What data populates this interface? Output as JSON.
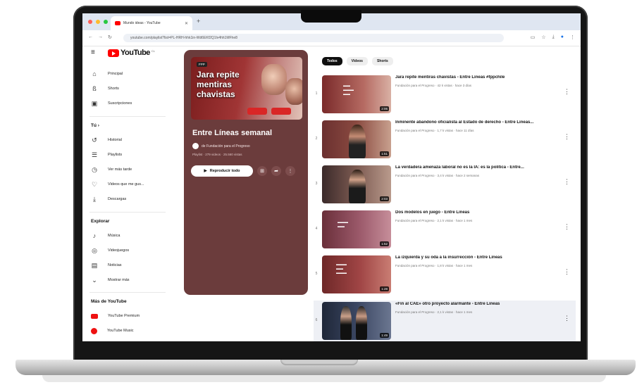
{
  "browser": {
    "tab_title": "Mundo ideas - YouTube",
    "url": "youtube.com/playlist?list=PL-HRH-hhk1in-Wd6EKf2Q1lv4hh1MFhe8",
    "dot_colors": [
      "#ff5f57",
      "#febc2e",
      "#28c840"
    ]
  },
  "header": {
    "logo_text": "YouTube"
  },
  "sidebar": {
    "main": [
      {
        "label": "Principal",
        "icon": "home-icon"
      },
      {
        "label": "Shorts",
        "icon": "shorts-icon"
      },
      {
        "label": "Suscripciones",
        "icon": "subscriptions-icon"
      }
    ],
    "you_heading": "Tú",
    "you_items": [
      {
        "label": "Historial",
        "icon": "history-icon"
      },
      {
        "label": "Playlists",
        "icon": "playlists-icon"
      },
      {
        "label": "Ver más tarde",
        "icon": "clock-icon"
      },
      {
        "label": "Videos que me gus...",
        "icon": "like-icon"
      },
      {
        "label": "Descargas",
        "icon": "download-icon"
      }
    ],
    "explore_heading": "Explorar",
    "explore_items": [
      {
        "label": "Música",
        "icon": "music-icon"
      },
      {
        "label": "Videojuegos",
        "icon": "gaming-icon"
      },
      {
        "label": "Noticias",
        "icon": "news-icon"
      },
      {
        "label": "Mostrar más",
        "icon": "chevron-down-icon"
      }
    ],
    "more_heading": "Más de YouTube",
    "more_items": [
      {
        "label": "YouTube Premium",
        "icon": "youtube-premium-icon"
      },
      {
        "label": "YouTube Music",
        "icon": "youtube-music-icon"
      }
    ]
  },
  "playlist": {
    "thumb_logo": "FPP",
    "thumb_title": "Jara repite mentiras chavistas",
    "title": "Entre Líneas semanal",
    "channel": "de Fundación para el Progreso",
    "meta": "Playlist · 279 videos · 25.560 vistas",
    "play_all": "Reproducir todo",
    "bg_color": "#6b3c3c"
  },
  "chips": [
    "Todos",
    "Videos",
    "Shorts"
  ],
  "videos": [
    {
      "num": "1",
      "title": "Jara repite mentiras chavistas - Entre Líneas #fppchile",
      "meta": "Fundación para el Progreso · 42 k vistas · hace 3 días",
      "duration": "2:06"
    },
    {
      "num": "2",
      "title": "Inminente abandono oficialista al Estado de derecho - Entre Líneas...",
      "meta": "Fundación para el Progreso · 1,7 k vistas · hace 11 días",
      "duration": "1:51"
    },
    {
      "num": "3",
      "title": "La verdadera amenaza laboral no es la IA: es la política - Entre...",
      "meta": "Fundación para el Progreso · 3,4 k vistas · hace 2 semanas",
      "duration": "2:03"
    },
    {
      "num": "4",
      "title": "Dos modelos en juego - Entre Líneas",
      "meta": "Fundación para el Progreso · 2,1 k vistas · hace 1 mes",
      "duration": "1:52"
    },
    {
      "num": "5",
      "title": "La izquierda y su oda a la insurrección - Entre Líneas",
      "meta": "Fundación para el Progreso · 1,8 k vistas · hace 1 mes",
      "duration": "1:28"
    },
    {
      "num": "6",
      "title": "«Fin al CAE» otro proyecto alarmante - Entre Líneas",
      "meta": "Fundación para el Progreso · 2,1 k vistas · hace 1 mes",
      "duration": "1:49"
    }
  ]
}
